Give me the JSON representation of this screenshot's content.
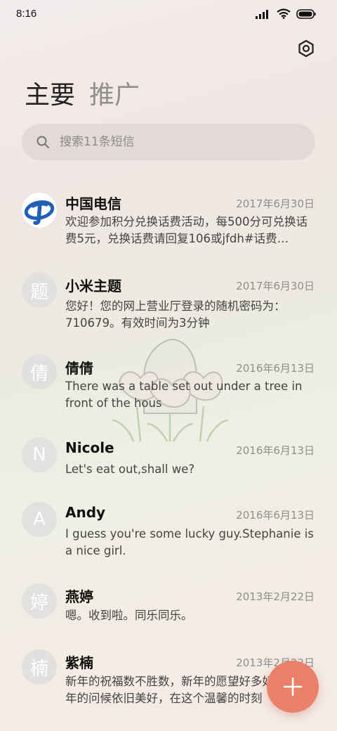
{
  "status_bar": {
    "time": "8:16"
  },
  "tabs": [
    {
      "label": "主要"
    },
    {
      "label": "推广"
    }
  ],
  "search": {
    "placeholder": "搜索11条短信"
  },
  "conversations": [
    {
      "name": "中国电信",
      "date": "2017年6月30日",
      "preview": "欢迎参加积分兑换话费活动，每500分可兑换话费5元，兑换话费请回复106或jfdh#话费…",
      "avatar": ""
    },
    {
      "name": "小米主题",
      "date": "2017年6月30日",
      "preview": "您好！您的网上营业厅登录的随机密码为：710679。有效时间为3分钟",
      "avatar": "题"
    },
    {
      "name": "倩倩",
      "date": "2016年6月13日",
      "preview": "There was a table set out under a tree in front of the hous",
      "avatar": "倩"
    },
    {
      "name": "Nicole",
      "date": "2016年6月13日",
      "preview": "Let's eat out,shall we?",
      "avatar": "N"
    },
    {
      "name": "Andy",
      "date": "2016年6月13日",
      "preview": "I guess you're some lucky guy.Stephanie is a nice girl.",
      "avatar": "A"
    },
    {
      "name": "燕婷",
      "date": "2013年2月22日",
      "preview": "嗯。收到啦。同乐同乐。",
      "avatar": "婷"
    },
    {
      "name": "紫楠",
      "date": "2013年2月22日",
      "preview": "新年的祝福数不胜数，新年的愿望好多好多，新年的问候依旧美好，在这个温馨的时刻",
      "avatar": "楠"
    }
  ],
  "colors": {
    "accent": "#e9806a",
    "telecom_blue": "#1f5fb5"
  },
  "icons": {
    "settings": "settings-icon",
    "search": "search-icon",
    "fab": "plus-icon"
  }
}
